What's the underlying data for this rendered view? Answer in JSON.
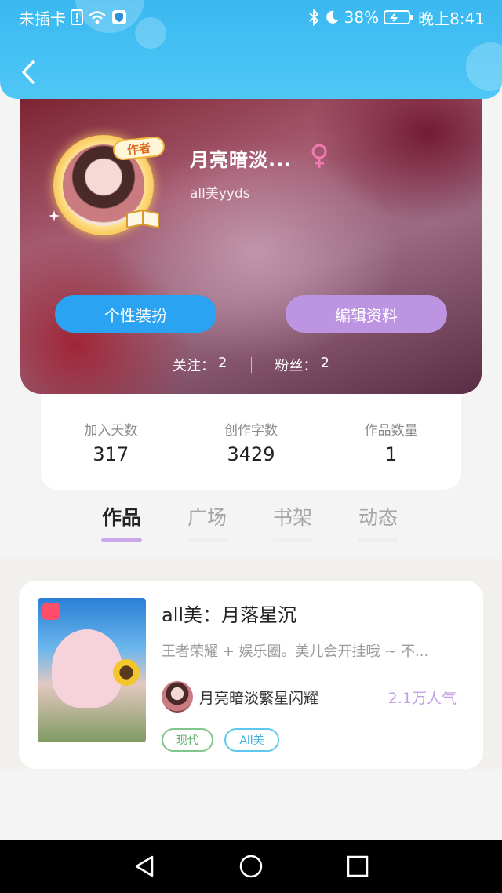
{
  "status_bar": {
    "carrier": "未插卡",
    "battery": "38%",
    "time": "晚上8:41"
  },
  "profile": {
    "name": "月亮暗淡...",
    "subtitle": "all美yyds",
    "author_badge": "作者",
    "decorate_button": "个性装扮",
    "edit_button": "编辑资料",
    "following_label": "关注：",
    "following_count": "2",
    "followers_label": "粉丝：",
    "followers_count": "2"
  },
  "stats": [
    {
      "label": "加入天数",
      "value": "317"
    },
    {
      "label": "创作字数",
      "value": "3429"
    },
    {
      "label": "作品数量",
      "value": "1"
    }
  ],
  "tabs": [
    {
      "label": "作品",
      "active": true
    },
    {
      "label": "广场",
      "active": false
    },
    {
      "label": "书架",
      "active": false
    },
    {
      "label": "动态",
      "active": false
    }
  ],
  "works": [
    {
      "title": "all美：月落星沉",
      "description": "王者荣耀 + 娱乐圈。美儿会开挂哦 ~ 不...",
      "author": "月亮暗淡繁星闪耀",
      "popularity": "2.1万人气",
      "tags": [
        "现代",
        "All美"
      ]
    }
  ],
  "colors": {
    "header": "#39b8f0",
    "decorate_button": "#2aa3f2",
    "edit_button": "#bd94e2",
    "tab_active_underline": "#c8a8ea",
    "popularity": "#c2a0e6"
  },
  "icons": {
    "back": "back-arrow-icon",
    "gender": "female-symbol-icon",
    "nav_back": "triangle-back-icon",
    "nav_home": "circle-home-icon",
    "nav_recents": "square-recents-icon"
  }
}
